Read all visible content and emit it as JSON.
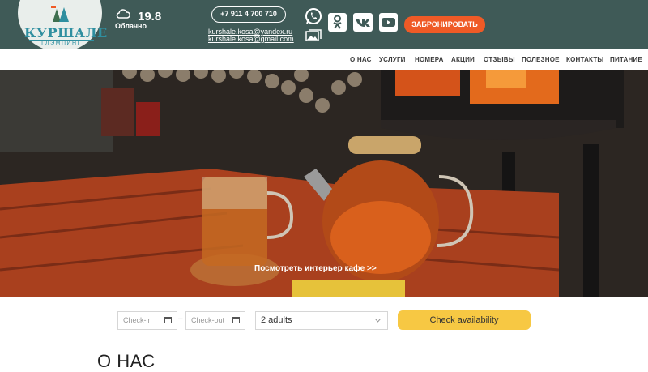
{
  "brand": {
    "title": "КУРШАЛЕ",
    "subtitle": "ГЛЭМПИНГ"
  },
  "weather": {
    "temperature": "19.8",
    "condition": "Облачно",
    "icon": "cloud-icon"
  },
  "contacts": {
    "phone": "+7 911 4 700 710",
    "emails": [
      "kurshale.kosa@yandex.ru",
      "kurshale.kosa@gmail.com"
    ]
  },
  "social": [
    "whatsapp-icon",
    "odnoklassniki-icon",
    "vk-icon",
    "youtube-icon",
    "gallery-icon"
  ],
  "header": {
    "book_label": "ЗАБРОНИРОВАТЬ"
  },
  "nav": {
    "items": [
      "О НАС",
      "УСЛУГИ",
      "НОМЕРА",
      "АКЦИИ",
      "ОТЗЫВЫ",
      "ПОЛЕЗНОЕ",
      "КОНТАКТЫ",
      "ПИТАНИЕ"
    ]
  },
  "hero": {
    "caption": "Посмотреть интерьер кафе >>"
  },
  "booking": {
    "checkin_placeholder": "Check-in",
    "separator": "–",
    "checkout_placeholder": "Check-out",
    "guests_value": "2 adults",
    "submit_label": "Check availability"
  },
  "section": {
    "title": "О НАС"
  },
  "colors": {
    "header_bg": "#3f5a57",
    "accent": "#ef5a26",
    "button_yellow": "#f7c843",
    "logo_teal": "#2f8fa0"
  }
}
